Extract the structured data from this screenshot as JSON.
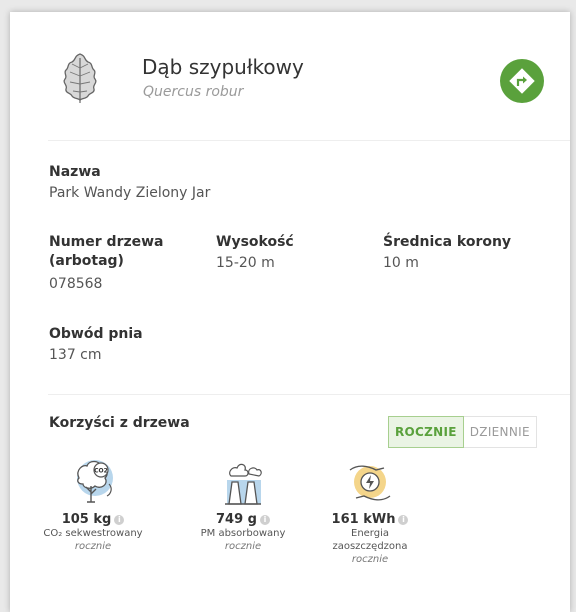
{
  "header": {
    "title": "Dąb szypułkowy",
    "latin_name": "Quercus robur",
    "leaf_icon": "oak-leaf-icon",
    "nav_icon": "directions-icon"
  },
  "details": {
    "name_label": "Nazwa",
    "name_value": "Park Wandy Zielony Jar",
    "tree_number_label_line1": "Numer drzewa",
    "tree_number_label_line2": "(arbotag)",
    "tree_number_value": "078568",
    "height_label": "Wysokość",
    "height_value": "15-20 m",
    "crown_label": "Średnica korony",
    "crown_value": "10 m",
    "trunk_label": "Obwód pnia",
    "trunk_value": "137 cm"
  },
  "benefits": {
    "title": "Korzyści z drzewa",
    "toggle": {
      "yearly": "ROCZNIE",
      "daily": "DZIENNIE",
      "active": "yearly"
    },
    "items": [
      {
        "icon": "co2-tree-icon",
        "value": "105 kg",
        "desc_line1": "CO₂ sekwestrowany",
        "desc_line2": "",
        "period": "rocznie"
      },
      {
        "icon": "factory-pm-icon",
        "value": "749 g",
        "desc_line1": "PM absorbowany",
        "desc_line2": "",
        "period": "rocznie"
      },
      {
        "icon": "energy-savings-icon",
        "value": "161 kWh",
        "desc_line1": "Energia",
        "desc_line2": "zaoszczędzona",
        "period": "rocznie"
      }
    ]
  },
  "colors": {
    "accent_green": "#5aa13c",
    "icon_blue": "#b8d6ec",
    "icon_yellow": "#f4d58a"
  }
}
